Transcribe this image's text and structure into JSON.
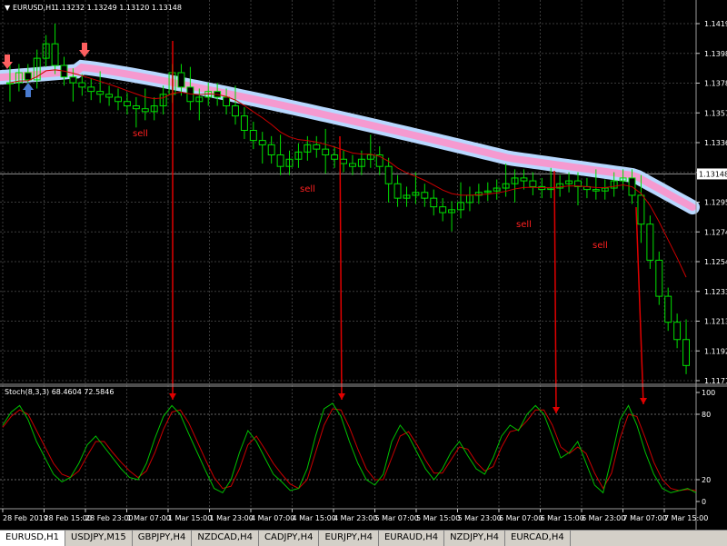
{
  "chart_header": {
    "symbol": "EURUSD,H1",
    "ohlc": "1.13232 1.13249 1.13120 1.13148"
  },
  "indicator_header": "Stoch(8,3,3) 68.4604 72.5846",
  "colors": {
    "background": "#000000",
    "grid": "#3a3a3a",
    "bull_candle": "#00e000",
    "bear_candle": "#00e000",
    "wick": "#00e000",
    "band_outer": "#b8d8ff",
    "band_inner": "#f59ad0",
    "ma_line": "#cc0000",
    "stoch_main": "#00c000",
    "stoch_signal": "#cc0000",
    "sell_text": "#ff2020",
    "arrow_red": "#ff6060",
    "arrow_blue": "#4a7bd0",
    "annotation_line": "#e00000",
    "price_label_bg": "#ffffff"
  },
  "chart_data": [
    {
      "type": "candlestick",
      "symbol": "EURUSD",
      "timeframe": "H1",
      "y_ticks": [
        "1.14190",
        "1.13985",
        "1.13780",
        "1.13570",
        "1.13365",
        "1.13148",
        "1.12955",
        "1.12745",
        "1.12540",
        "1.12335",
        "1.12130",
        "1.11920",
        "1.11715"
      ],
      "current_price": "1.13148",
      "ylim": [
        1.11715,
        1.1419
      ],
      "x_ticks": [
        "28 Feb 2019",
        "28 Feb 15:00",
        "28 Feb 23:00",
        "1 Mar 07:00",
        "1 Mar 15:00",
        "1 Mar 23:00",
        "4 Mar 07:00",
        "4 Mar 15:00",
        "4 Mar 23:00",
        "5 Mar 07:00",
        "5 Mar 15:00",
        "5 Mar 23:00",
        "6 Mar 07:00",
        "6 Mar 15:00",
        "6 Mar 23:00",
        "7 Mar 07:00",
        "7 Mar 15:00"
      ],
      "close_path": [
        1.1378,
        1.1385,
        1.138,
        1.1395,
        1.1405,
        1.139,
        1.1382,
        1.1378,
        1.1375,
        1.1372,
        1.137,
        1.1368,
        1.1365,
        1.1362,
        1.136,
        1.1358,
        1.1362,
        1.137,
        1.1385,
        1.1375,
        1.1365,
        1.1368,
        1.1372,
        1.1368,
        1.1362,
        1.1355,
        1.1345,
        1.1338,
        1.1335,
        1.1328,
        1.132,
        1.1325,
        1.133,
        1.1335,
        1.1332,
        1.1328,
        1.1325,
        1.1322,
        1.132,
        1.1325,
        1.1328,
        1.132,
        1.1308,
        1.1298,
        1.13,
        1.1302,
        1.1298,
        1.1292,
        1.1288,
        1.129,
        1.1295,
        1.13,
        1.1302,
        1.1303,
        1.1305,
        1.1308,
        1.1312,
        1.131,
        1.1306,
        1.1304,
        1.1305,
        1.1308,
        1.131,
        1.1306,
        1.1304,
        1.1303,
        1.1305,
        1.131,
        1.1312,
        1.13,
        1.128,
        1.1255,
        1.123,
        1.1212,
        1.12,
        1.1182
      ],
      "annotations": [
        "sell",
        "sell",
        "sell",
        "sell"
      ]
    },
    {
      "type": "line",
      "name": "Stoch(8,3,3)",
      "y_ticks": [
        "100",
        "80",
        "20",
        "0"
      ],
      "ylim": [
        0,
        100
      ],
      "series_main": [
        70,
        82,
        88,
        75,
        55,
        40,
        25,
        18,
        22,
        35,
        52,
        60,
        50,
        40,
        30,
        22,
        20,
        35,
        58,
        78,
        88,
        80,
        62,
        45,
        28,
        12,
        8,
        20,
        45,
        65,
        55,
        40,
        25,
        18,
        10,
        12,
        30,
        60,
        85,
        90,
        78,
        55,
        35,
        20,
        15,
        25,
        55,
        70,
        60,
        45,
        30,
        20,
        30,
        45,
        55,
        42,
        30,
        25,
        40,
        60,
        70,
        65,
        80,
        88,
        80,
        60,
        40,
        45,
        55,
        35,
        15,
        8,
        40,
        75,
        88,
        70,
        45,
        25,
        12,
        8,
        10,
        12,
        8
      ],
      "series_signal": [
        68,
        78,
        84,
        80,
        65,
        50,
        35,
        25,
        22,
        28,
        42,
        55,
        55,
        45,
        36,
        28,
        22,
        28,
        45,
        66,
        82,
        84,
        72,
        55,
        38,
        22,
        12,
        14,
        30,
        52,
        60,
        48,
        35,
        25,
        16,
        12,
        20,
        45,
        70,
        85,
        84,
        68,
        48,
        30,
        20,
        20,
        40,
        60,
        64,
        52,
        38,
        26,
        26,
        38,
        50,
        48,
        36,
        28,
        32,
        50,
        64,
        66,
        74,
        84,
        84,
        70,
        50,
        44,
        50,
        44,
        26,
        12,
        26,
        58,
        80,
        78,
        58,
        36,
        20,
        12,
        10,
        11,
        10
      ]
    }
  ],
  "sell_labels": [
    "sell",
    "sell",
    "sell",
    "sell"
  ],
  "tabs": [
    "EURUSD,H1",
    "USDJPY,M15",
    "GBPJPY,H4",
    "NZDCAD,H4",
    "CADJPY,H4",
    "EURJPY,H4",
    "EURAUD,H4",
    "NZDJPY,H4",
    "EURCAD,H4"
  ],
  "active_tab": "EURUSD,H1",
  "icons": [
    "triangle-down-icon",
    "arrow-down-icon",
    "arrow-up-icon"
  ]
}
